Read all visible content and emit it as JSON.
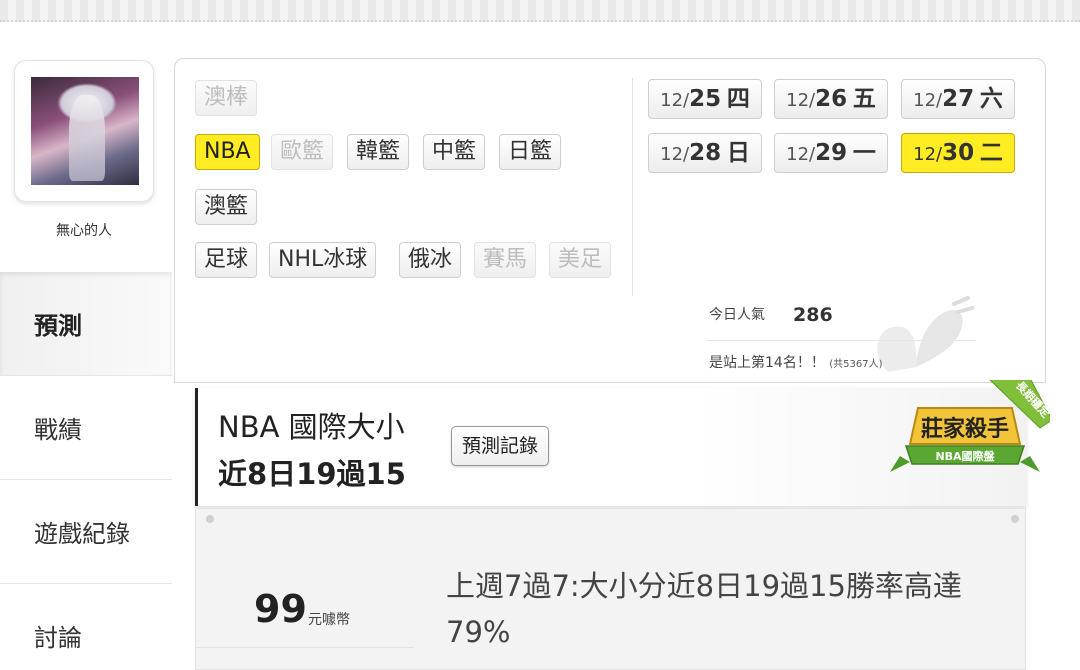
{
  "user": {
    "name": "無心的人"
  },
  "sidebar": {
    "items": [
      {
        "label": "預測",
        "active": true
      },
      {
        "label": "戰績"
      },
      {
        "label": "遊戲紀錄"
      },
      {
        "label": "討論"
      }
    ]
  },
  "categories": {
    "row1": [
      {
        "label": "澳棒",
        "disabled": true
      }
    ],
    "row2": [
      {
        "label": "NBA",
        "active": true
      },
      {
        "label": "歐籃",
        "disabled": true
      },
      {
        "label": "韓籃"
      },
      {
        "label": "中籃"
      },
      {
        "label": "日籃"
      }
    ],
    "row3": [
      {
        "label": "澳籃"
      }
    ],
    "row4": [
      {
        "label": "足球"
      },
      {
        "label": "NHL冰球"
      },
      {
        "label": "俄冰"
      },
      {
        "label": "賽馬",
        "disabled": true
      },
      {
        "label": "美足",
        "disabled": true
      }
    ]
  },
  "dates": [
    {
      "month": "12/",
      "day": "25",
      "weekday": "四"
    },
    {
      "month": "12/",
      "day": "26",
      "weekday": "五"
    },
    {
      "month": "12/",
      "day": "27",
      "weekday": "六"
    },
    {
      "month": "12/",
      "day": "28",
      "weekday": "日"
    },
    {
      "month": "12/",
      "day": "29",
      "weekday": "一"
    },
    {
      "month": "12/",
      "day": "30",
      "weekday": "二",
      "active": true
    }
  ],
  "stats": {
    "popularity_label": "今日人氣",
    "popularity_value": "286",
    "rank_text": "是站上第14名！！",
    "rank_total": "(共5367人)"
  },
  "prediction": {
    "title": "NBA 國際大小",
    "subtitle": "近8日19過15",
    "record_button": "預測記錄",
    "badge_main": "莊家殺手",
    "badge_sub": "NBA國際盤",
    "badge_ribbon": "長期穩定"
  },
  "offer": {
    "price": "99",
    "unit": "元噱幣",
    "description": "上週7過7:大小分近8日19過15勝率高達79%"
  },
  "colors": {
    "highlight": "#ffec22",
    "badge_green": "#5aa832",
    "badge_gold": "#e0b020"
  }
}
